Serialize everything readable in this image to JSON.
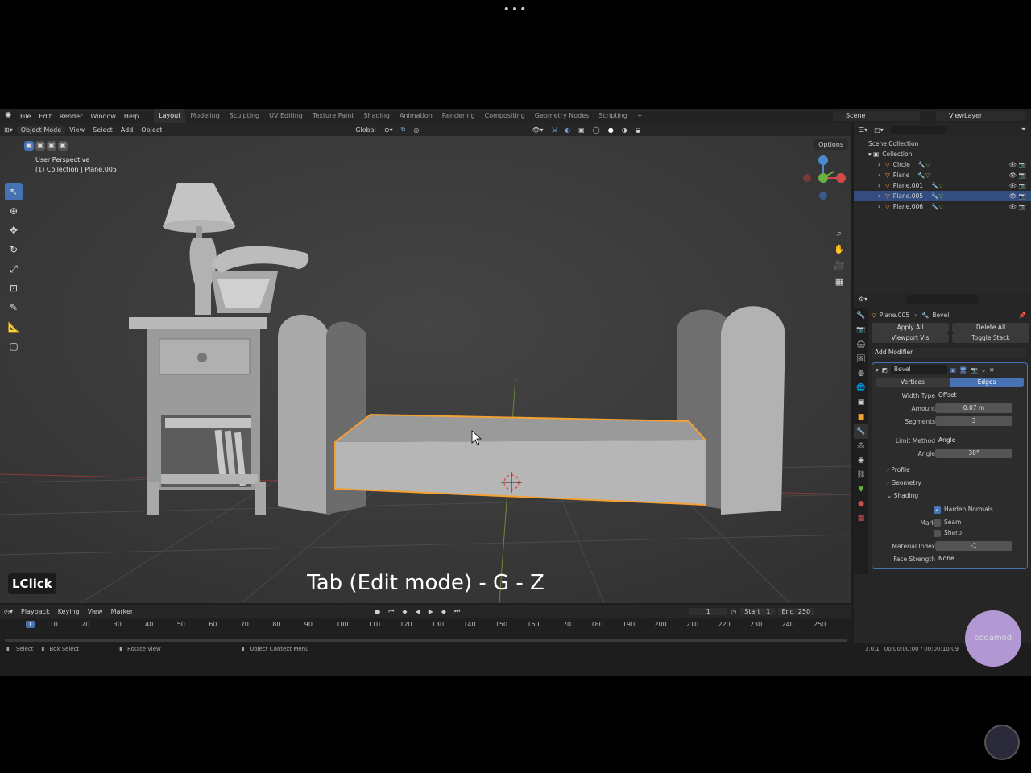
{
  "window_dots": "•••",
  "menus": [
    "File",
    "Edit",
    "Render",
    "Window",
    "Help"
  ],
  "workspaces": [
    "Layout",
    "Modeling",
    "Sculpting",
    "UV Editing",
    "Texture Paint",
    "Shading",
    "Animation",
    "Rendering",
    "Compositing",
    "Geometry Nodes",
    "Scripting"
  ],
  "active_workspace": "Layout",
  "scene": "Scene",
  "view_layer": "ViewLayer",
  "viewport_header": {
    "mode": "Object Mode",
    "view": "View",
    "select": "Select",
    "add": "Add",
    "object": "Object",
    "orientation": "Global",
    "options": "Options"
  },
  "viewport_info": {
    "perspective": "User Perspective",
    "collection": "(1) Collection | Plane.005"
  },
  "input_indicator": "LClick",
  "caption": "Tab (Edit mode) - G - Z",
  "timeline": {
    "playback": "Playback",
    "keying": "Keying",
    "view": "View",
    "marker": "Marker",
    "current_frame": "1",
    "start_label": "Start",
    "start": "1",
    "end_label": "End",
    "end": "250",
    "ticks": [
      "1",
      "10",
      "20",
      "30",
      "40",
      "50",
      "60",
      "70",
      "80",
      "90",
      "100",
      "110",
      "120",
      "130",
      "140",
      "150",
      "160",
      "170",
      "180",
      "190",
      "200",
      "210",
      "220",
      "230",
      "240",
      "250"
    ]
  },
  "statusbar": {
    "select": "Select",
    "box_select": "Box Select",
    "rotate_view": "Rotate View",
    "context_menu": "Object Context Menu",
    "version": "3.0.1",
    "time": "00:00:00:00 / 00:00:10:09"
  },
  "outliner": {
    "root": "Scene Collection",
    "collection": "Collection",
    "items": [
      {
        "name": "Circle",
        "selected": false
      },
      {
        "name": "Plane",
        "selected": false
      },
      {
        "name": "Plane.001",
        "selected": false
      },
      {
        "name": "Plane.005",
        "selected": true
      },
      {
        "name": "Plane.006",
        "selected": false
      }
    ]
  },
  "properties": {
    "object": "Plane.005",
    "modifier_crumb": "Bevel",
    "apply_all": "Apply All",
    "delete_all": "Delete All",
    "viewport_vis": "Viewport Vis",
    "toggle_stack": "Toggle Stack",
    "add_modifier": "Add Modifier",
    "modifier_name": "Bevel",
    "vertices": "Vertices",
    "edges": "Edges",
    "width_type_label": "Width Type",
    "width_type": "Offset",
    "amount_label": "Amount",
    "amount": "0.07 m",
    "segments_label": "Segments",
    "segments": "3",
    "limit_method_label": "Limit Method",
    "limit_method": "Angle",
    "angle_label": "Angle",
    "angle": "30°",
    "profile": "Profile",
    "geometry": "Geometry",
    "shading": "Shading",
    "harden_normals": "Harden Normals",
    "mark_label": "Mark",
    "seam": "Seam",
    "sharp": "Sharp",
    "material_index_label": "Material Index",
    "material_index": "-1",
    "face_strength_label": "Face Strength",
    "face_strength": "None"
  },
  "logo_text": "codamod",
  "colors": {
    "selection_outline": "#f5a033",
    "accent": "#4772b3",
    "viewport_bg": "#3c3c3c"
  }
}
